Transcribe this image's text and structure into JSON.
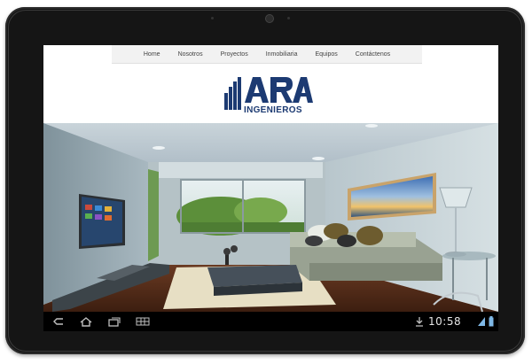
{
  "nav": {
    "items": [
      {
        "label": "Home"
      },
      {
        "label": "Nosotros"
      },
      {
        "label": "Proyectos"
      },
      {
        "label": "Inmobiliaria"
      },
      {
        "label": "Equipos"
      },
      {
        "label": "Contáctenos"
      }
    ]
  },
  "brand": {
    "logo_text": "ARA",
    "logo_sub": "INGENIEROS",
    "color": "#1c3a72"
  },
  "hero": {
    "image": "living-room-interior"
  },
  "system_bar": {
    "time": "10:58",
    "icons": [
      "back-icon",
      "home-icon",
      "recent-apps-icon",
      "menu-icon",
      "download-icon",
      "wifi-icon",
      "battery-icon"
    ]
  }
}
